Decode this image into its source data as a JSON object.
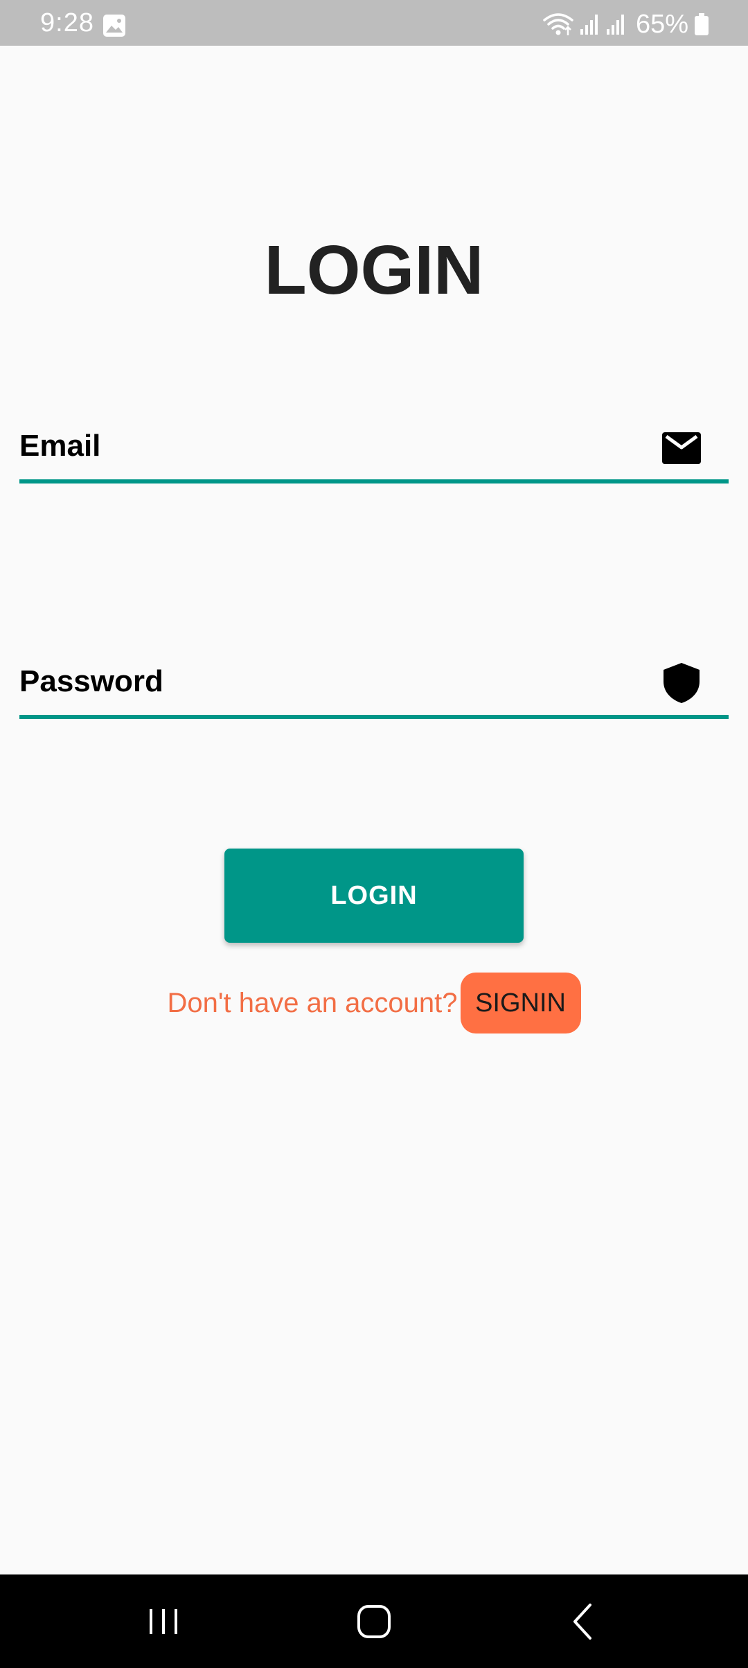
{
  "status_bar": {
    "time": "9:28",
    "battery_percent": "65%",
    "icons": [
      "gallery-icon",
      "wifi-icon",
      "signal-icon",
      "signal-icon",
      "battery-icon"
    ]
  },
  "login_screen": {
    "title": "LOGIN",
    "email_field": {
      "placeholder": "Email",
      "value": "",
      "icon": "envelope-icon"
    },
    "password_field": {
      "placeholder": "Password",
      "value": "",
      "icon": "shield-icon"
    },
    "login_button_label": "LOGIN",
    "signup_prompt": "Don't have an account?",
    "signin_button_label": "SIGNIN"
  },
  "nav_bar": {
    "icons": [
      "recents-icon",
      "home-icon",
      "back-icon"
    ]
  },
  "colors": {
    "accent": "#009688",
    "signin": "#ff7043",
    "prompt_text": "#f26e45",
    "background": "#fafafa",
    "status_bar": "#bdbdbd"
  }
}
